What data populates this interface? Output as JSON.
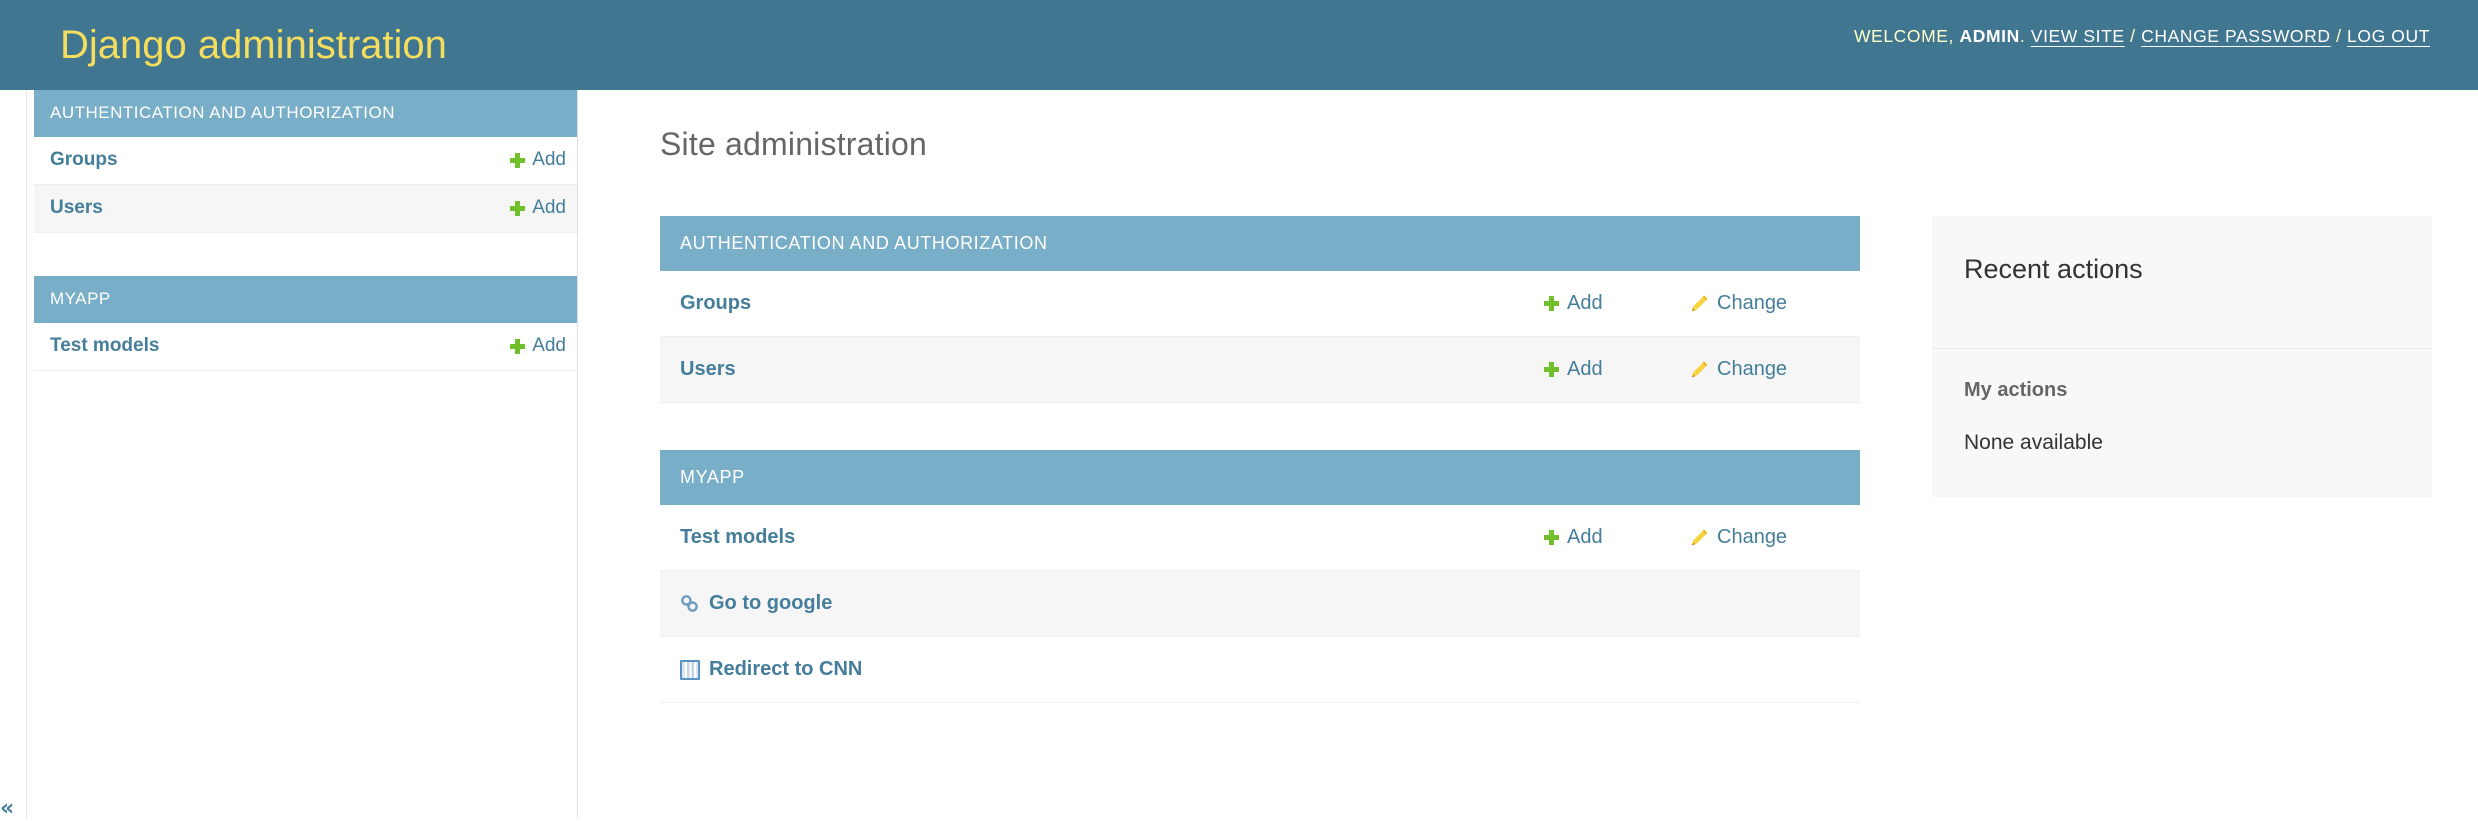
{
  "header": {
    "site_title": "Django administration",
    "welcome_label": "Welcome,",
    "username": "ADMIN",
    "period": ".",
    "links": [
      {
        "label": "VIEW SITE",
        "name": "view-site-link"
      },
      {
        "label": "CHANGE PASSWORD",
        "name": "change-password-link"
      },
      {
        "label": "LOG OUT",
        "name": "log-out-link"
      }
    ],
    "separator": "/"
  },
  "sidebar": {
    "toggle_glyph": "«",
    "apps": [
      {
        "caption": "AUTHENTICATION AND AUTHORIZATION",
        "models": [
          {
            "name": "Groups",
            "add_label": "Add"
          },
          {
            "name": "Users",
            "add_label": "Add"
          }
        ]
      },
      {
        "caption": "MYAPP",
        "models": [
          {
            "name": "Test models",
            "add_label": "Add"
          }
        ]
      }
    ]
  },
  "main": {
    "title": "Site administration",
    "apps": [
      {
        "caption": "AUTHENTICATION AND AUTHORIZATION",
        "rows": [
          {
            "name": "Groups",
            "add_label": "Add",
            "change_label": "Change",
            "icon": "none"
          },
          {
            "name": "Users",
            "add_label": "Add",
            "change_label": "Change",
            "icon": "none"
          }
        ]
      },
      {
        "caption": "MYAPP",
        "rows": [
          {
            "name": "Test models",
            "add_label": "Add",
            "change_label": "Change",
            "icon": "none"
          },
          {
            "name": "Go to google",
            "add_label": "",
            "change_label": "",
            "icon": "chain-link-icon"
          },
          {
            "name": "Redirect to CNN",
            "add_label": "",
            "change_label": "",
            "icon": "window-icon"
          }
        ]
      }
    ]
  },
  "recent_actions": {
    "title": "Recent actions",
    "subtitle": "My actions",
    "empty_text": "None available"
  },
  "colors": {
    "header_bg": "#417690",
    "brand_text": "#f5dd5d",
    "module_caption_bg": "#79aec8",
    "link": "#447e9b",
    "add_icon": "#70bf2b",
    "change_icon": "#efb80b",
    "row_alt_bg": "#f6f6f6",
    "related_bg": "#f8f8f8"
  }
}
